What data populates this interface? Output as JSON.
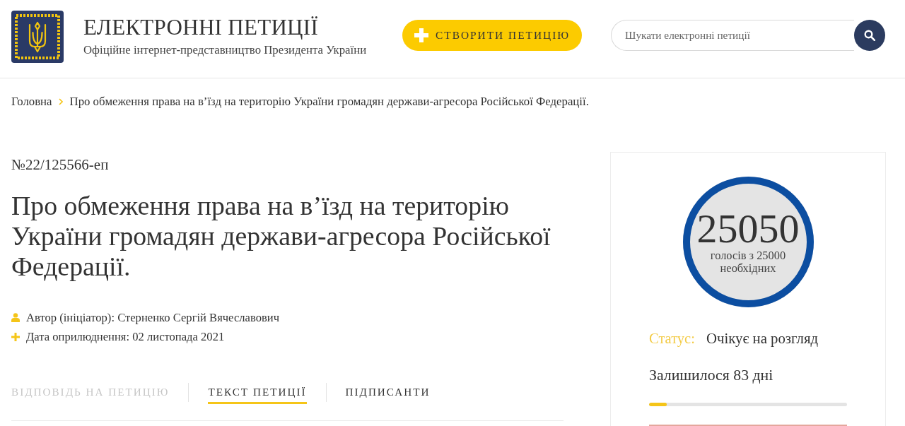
{
  "header": {
    "title": "ЕЛЕКТРОННІ ПЕТИЦІЇ",
    "subtitle": "Офіційне інтернет-представництво Президента України",
    "create_button": "СТВОРИТИ ПЕТИЦІЮ",
    "search": {
      "placeholder": "Шукати електронні петиції"
    }
  },
  "breadcrumb": [
    "Головна",
    "Про обмеження права на в’їзд на територію України громадян держави-агресора Російської Федерації."
  ],
  "petition": {
    "number": "№22/125566-еп",
    "title": "Про обмеження права на в’їзд на територію України громадян держави-агресора Російської Федерації.",
    "meta": [
      {
        "kind": "author",
        "text": "Автор (ініціатор): Стерненко Сергій Вячеславович"
      },
      {
        "kind": "date",
        "text": "Дата оприлюднення: 02 листопада 2021"
      }
    ]
  },
  "tabs": [
    {
      "label": "ВІДПОВІДЬ НА ПЕТИЦІЮ",
      "selected": false,
      "disabled": true
    },
    {
      "label": "ТЕКСТ ПЕТИЦІЇ",
      "selected": true,
      "disabled": false
    },
    {
      "label": "ПІДПИСАНТИ",
      "selected": false,
      "disabled": false
    }
  ],
  "votes": {
    "count": "25050",
    "caption": "голосів з 25000 необхідних",
    "level": 1
  },
  "status": {
    "label": "Статус:",
    "value": "Очікує на розгляд"
  },
  "remaining": {
    "text": "Залишилося 83 дні",
    "level": 0.09
  }
}
